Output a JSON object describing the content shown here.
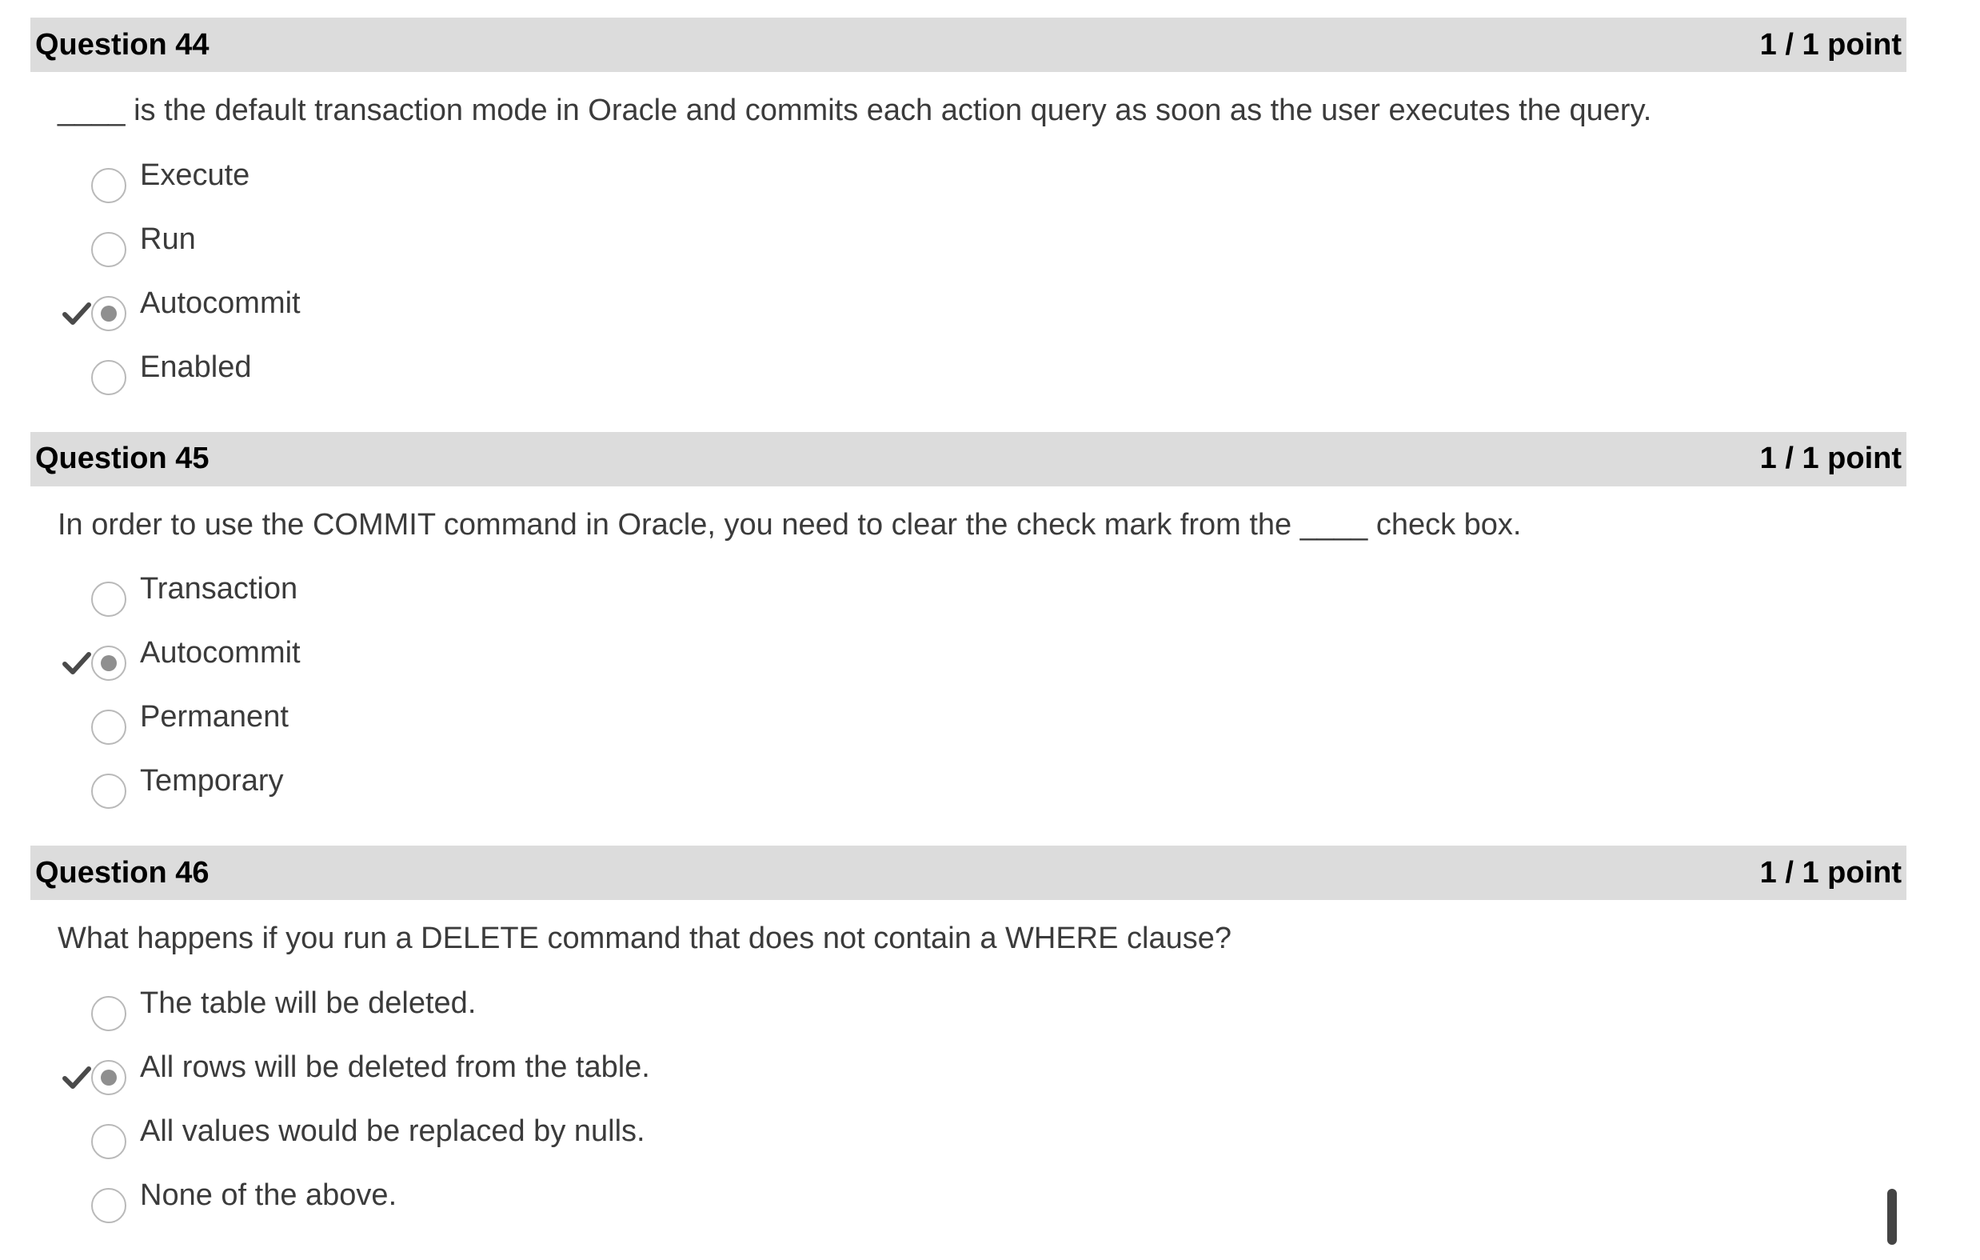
{
  "questions": [
    {
      "title": "Question 44",
      "score": "1 / 1 point",
      "prompt": "____ is the default transaction mode in Oracle and commits each action query as soon as the user executes the query.",
      "options": [
        {
          "label": "Execute",
          "selected": false,
          "correct_mark": false
        },
        {
          "label": "Run",
          "selected": false,
          "correct_mark": false
        },
        {
          "label": "Autocommit",
          "selected": true,
          "correct_mark": true
        },
        {
          "label": "Enabled",
          "selected": false,
          "correct_mark": false
        }
      ]
    },
    {
      "title": "Question 45",
      "score": "1 / 1 point",
      "prompt": "In order to use the COMMIT command in Oracle, you need to clear the check mark from the ____ check box.",
      "options": [
        {
          "label": "Transaction",
          "selected": false,
          "correct_mark": false
        },
        {
          "label": "Autocommit",
          "selected": true,
          "correct_mark": true
        },
        {
          "label": "Permanent",
          "selected": false,
          "correct_mark": false
        },
        {
          "label": "Temporary",
          "selected": false,
          "correct_mark": false
        }
      ]
    },
    {
      "title": "Question 46",
      "score": "1 / 1 point",
      "prompt": "What happens if you run a DELETE command that does not contain a WHERE clause?",
      "options": [
        {
          "label": "The table will be deleted.",
          "selected": false,
          "correct_mark": false
        },
        {
          "label": "All rows will be deleted from the table.",
          "selected": true,
          "correct_mark": true
        },
        {
          "label": "All values would be replaced by nulls.",
          "selected": false,
          "correct_mark": false
        },
        {
          "label": "None of the above.",
          "selected": false,
          "correct_mark": false
        }
      ]
    }
  ],
  "icons": {
    "correct": "checkmark-icon",
    "radio": "radio-button"
  },
  "colors": {
    "header_bg": "#dcdcdc",
    "check": "#4a4a4a",
    "radio_border": "#b9b9b9",
    "radio_dot": "#8f8f8f"
  }
}
